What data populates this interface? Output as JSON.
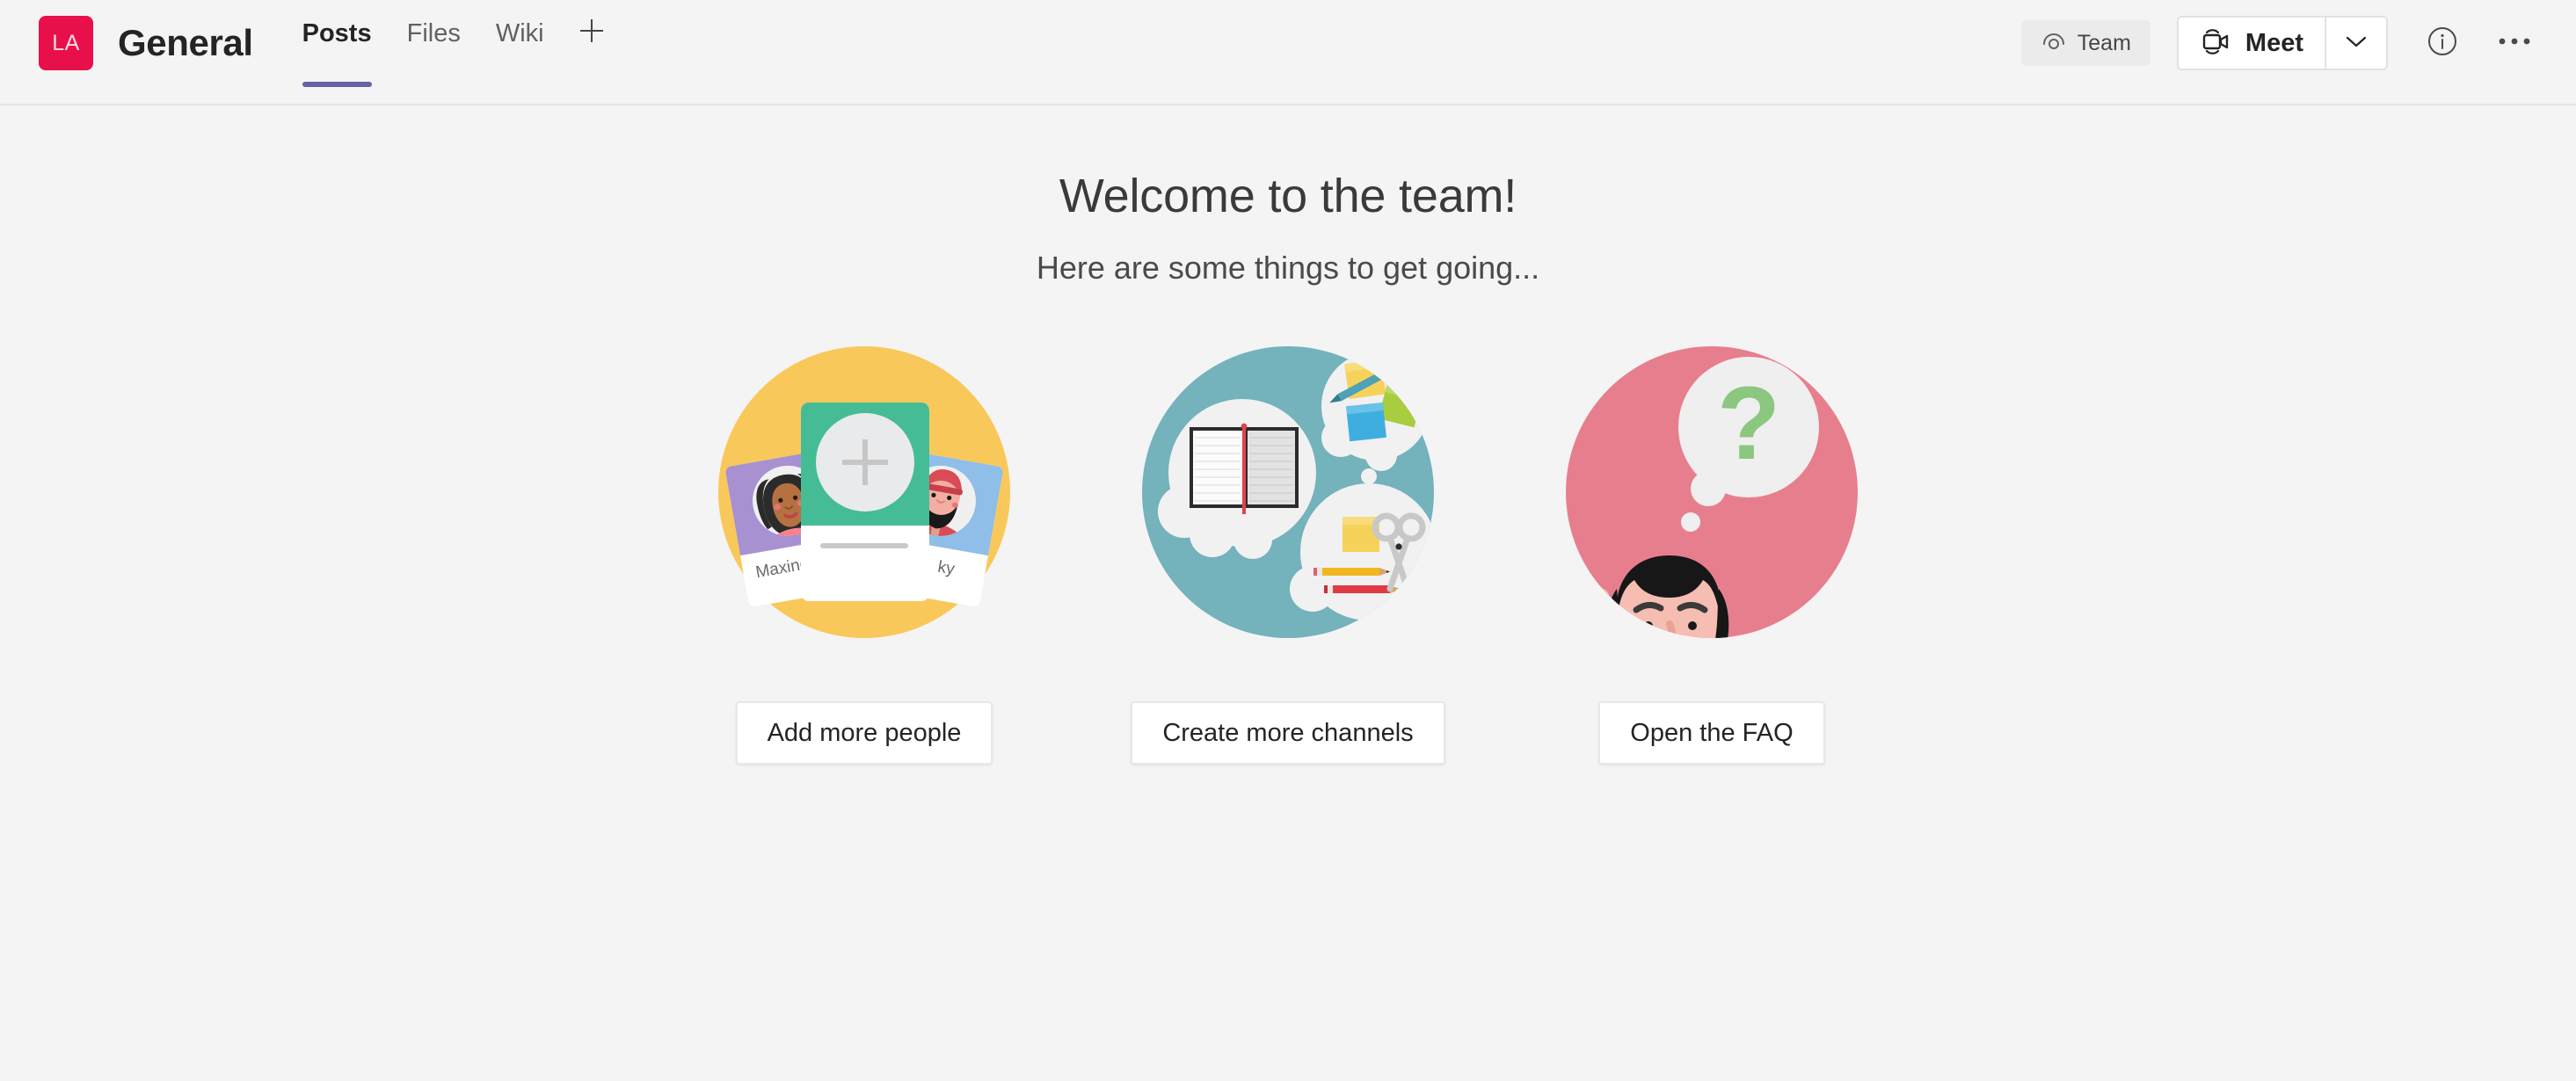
{
  "header": {
    "team_avatar": {
      "initials": "LA",
      "color": "#E8104A"
    },
    "channel_title": "General",
    "tabs": [
      {
        "label": "Posts",
        "active": true
      },
      {
        "label": "Files",
        "active": false
      },
      {
        "label": "Wiki",
        "active": false
      }
    ],
    "add_tab_icon": "plus-icon",
    "active_tab_indicator_color": "#6264A7",
    "team_pill": {
      "label": "Team",
      "icon": "team-visibility-icon"
    },
    "meet": {
      "label": "Meet",
      "icon": "video-camera-icon",
      "caret_icon": "chevron-down-icon"
    },
    "info_icon": "info-circle-icon",
    "more_icon": "more-horizontal-icon"
  },
  "main": {
    "title": "Welcome to the team!",
    "subtitle": "Here are some things to get going...",
    "cards": [
      {
        "illustration": "add-people-illustration",
        "circle_color": "#F9C85A",
        "button_label": "Add more people",
        "people_names": [
          "Maxine",
          "ky"
        ],
        "center_card_color": "#45BC96",
        "left_card_color": "#A891D0",
        "right_card_color": "#8FBEE8",
        "plus_icon": "plus-icon"
      },
      {
        "illustration": "create-channels-illustration",
        "circle_color": "#74B2BC",
        "button_label": "Create more channels",
        "notebook_spine_color": "#E8404A",
        "sticky_colors": [
          "#F7D154",
          "#3EAEE0",
          "#A8CD3F"
        ],
        "pencil_colors": [
          "#F2B71E",
          "#E03B45"
        ]
      },
      {
        "illustration": "open-faq-illustration",
        "circle_color": "#E77E8E",
        "button_label": "Open the FAQ",
        "question_mark": "?",
        "question_mark_color": "#8BC77F",
        "bubble_color": "#EFEFEF"
      }
    ]
  },
  "colors": {
    "page_background": "#F4F4F4",
    "header_background": "#F4F4F4",
    "accent_purple": "#6264A7",
    "text_primary": "#252423",
    "text_secondary": "#616161"
  }
}
